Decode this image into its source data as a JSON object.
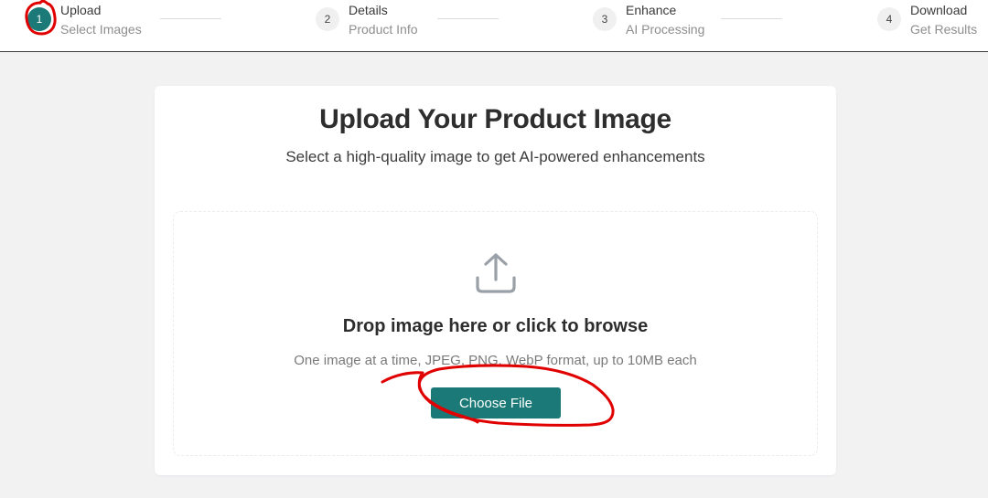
{
  "steps": [
    {
      "number": "1",
      "title": "Upload",
      "subtitle": "Select Images",
      "active": true
    },
    {
      "number": "2",
      "title": "Details",
      "subtitle": "Product Info",
      "active": false
    },
    {
      "number": "3",
      "title": "Enhance",
      "subtitle": "AI Processing",
      "active": false
    },
    {
      "number": "4",
      "title": "Download",
      "subtitle": "Get Results",
      "active": false
    }
  ],
  "upload": {
    "title": "Upload Your Product Image",
    "subtitle": "Select a high-quality image to get AI-powered enhancements",
    "dropzone": {
      "icon": "upload-icon",
      "title": "Drop image here or click to browse",
      "hint": "One image at a time, JPEG, PNG, WebP format, up to 10MB each",
      "button_label": "Choose File"
    }
  },
  "colors": {
    "accent": "#1b7a77",
    "annotation": "#e00000"
  }
}
